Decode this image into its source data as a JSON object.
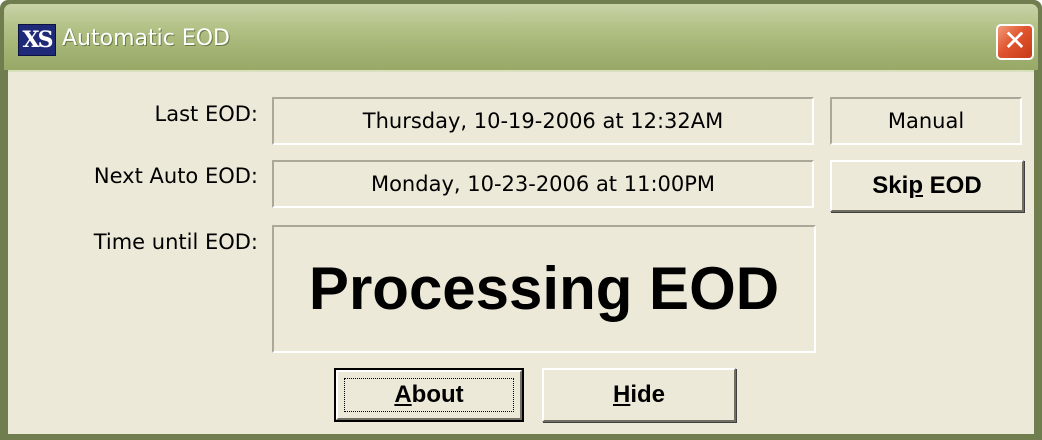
{
  "window": {
    "title": "Automatic EOD",
    "app_icon_text": "XS",
    "app_icon": "xs-app-icon",
    "close_icon": "close-icon",
    "close_glyph": "✕",
    "titlebar_color": "#a2b373",
    "client_color": "#ece9d8",
    "close_color": "#e0552f"
  },
  "fields": {
    "last_eod_label": "Last EOD:",
    "last_eod_value": "Thursday, 10-19-2006 at 12:32AM",
    "last_eod_mode": "Manual",
    "next_auto_eod_label": "Next Auto EOD:",
    "next_auto_eod_value": "Monday, 10-23-2006 at 11:00PM",
    "time_until_eod_label": "Time until EOD:",
    "time_until_eod_value": "Processing EOD"
  },
  "buttons": {
    "skip_eod_pre": "Ski",
    "skip_eod_mnemonic": "p",
    "skip_eod_post": " EOD",
    "about_mnemonic": "A",
    "about_rest": "bout",
    "hide_mnemonic": "H",
    "hide_rest": "ide"
  }
}
